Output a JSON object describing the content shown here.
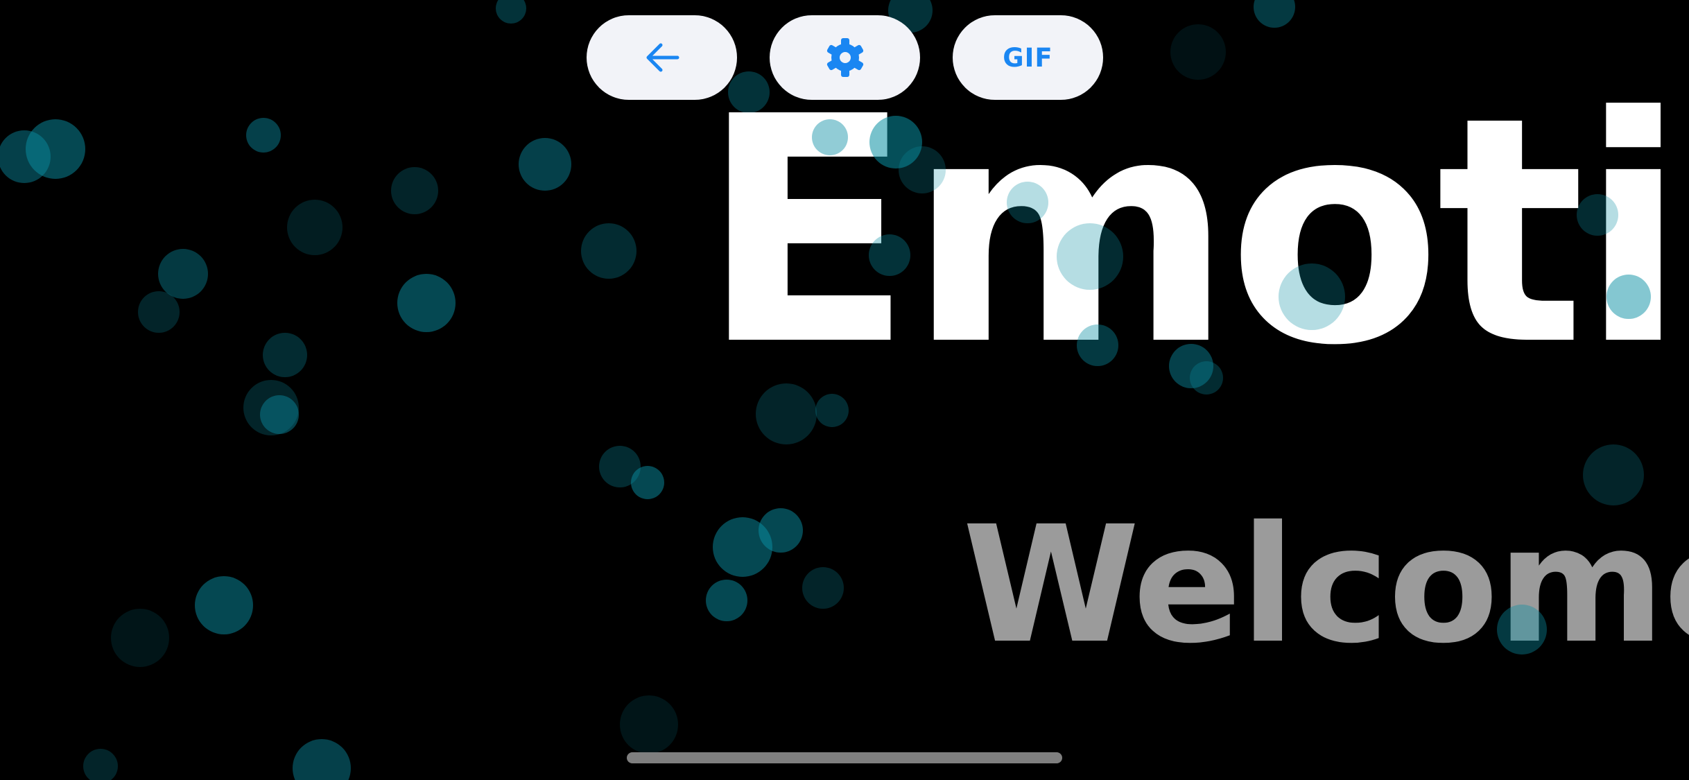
{
  "app": {
    "title": "EmotiS",
    "subtitle": "Welcome"
  },
  "toolbar": {
    "back_icon": "arrow-left-icon",
    "settings_icon": "gear-icon",
    "gif_label": "GIF"
  },
  "colors": {
    "background": "#000000",
    "button_bg": "#F2F3F8",
    "accent": "#1A86F2",
    "title": "#FFFFFF",
    "subtitle": "#9B9B9B",
    "bubble": "#0A8FA3",
    "home_indicator": "#7F7F7F"
  }
}
